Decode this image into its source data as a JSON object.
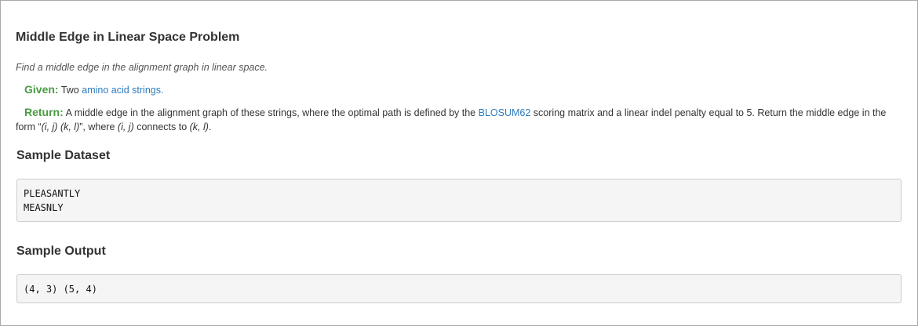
{
  "problem": {
    "title": "Middle Edge in Linear Space Problem",
    "summary": "Find a middle edge in the alignment graph in linear space.",
    "given": {
      "label": "Given:",
      "text": "Two",
      "link_text": "amino acid strings",
      "end": "."
    },
    "return": {
      "label": "Return:",
      "text_1": "A middle edge in the alignment graph of these strings, where the optimal path is defined by the",
      "link_text": "BLOSUM62",
      "text_2": "scoring matrix and a linear indel penalty equal to 5. Return the middle edge in the form “",
      "edge_i_j": "(i, j)",
      "edge_k_l": "(k, l)",
      "text_3": "”, where",
      "where_i_j": "(i, j)",
      "text_4": "connects to",
      "where_k_l": "(k, l)",
      "text_end": "."
    }
  },
  "sample_dataset": {
    "heading": "Sample Dataset",
    "lines": [
      "PLEASANTLY",
      "MEASNLY"
    ]
  },
  "sample_output": {
    "heading": "Sample Output",
    "lines": [
      "(4, 3) (5, 4)"
    ]
  }
}
